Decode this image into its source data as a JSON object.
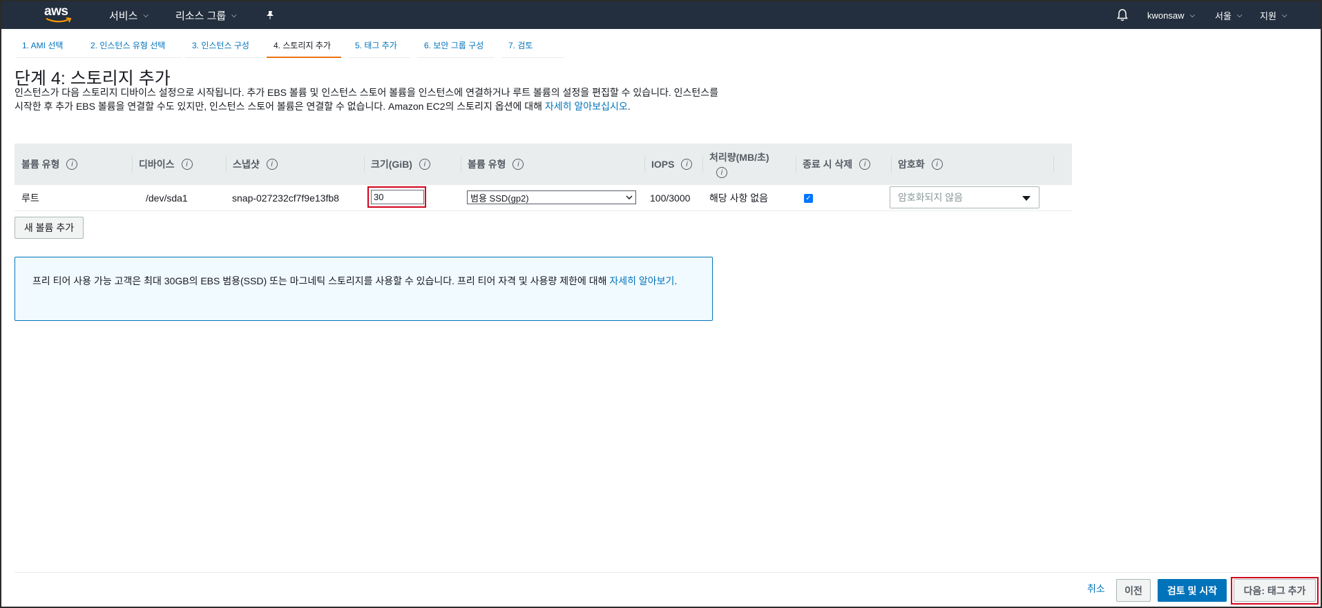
{
  "nav": {
    "logo": "aws",
    "services": "서비스",
    "resource_groups": "리소스 그룹",
    "user": "kwonsaw",
    "region": "서울",
    "support": "지원"
  },
  "tabs": [
    {
      "label": "1. AMI 선택"
    },
    {
      "label": "2. 인스턴스 유형 선택"
    },
    {
      "label": "3. 인스턴스 구성"
    },
    {
      "label": "4. 스토리지 추가"
    },
    {
      "label": "5. 태그 추가"
    },
    {
      "label": "6. 보안 그룹 구성"
    },
    {
      "label": "7. 검토"
    }
  ],
  "page": {
    "title": "단계 4: 스토리지 추가",
    "description": "인스턴스가 다음 스토리지 디바이스 설정으로 시작됩니다. 추가 EBS 볼륨 및 인스턴스 스토어 볼륨을 인스턴스에 연결하거나 루트 볼륨의 설정을 편집할 수 있습니다. 인스턴스를 시작한 후 추가 EBS 볼륨을 연결할 수도 있지만, 인스턴스 스토어 볼륨은 연결할 수 없습니다. Amazon EC2의 스토리지 옵션에 대해 ",
    "description_link": "자세히 알아보십시오",
    "description_end": "."
  },
  "table": {
    "headers": {
      "volume_type": "볼륨 유형",
      "device": "디바이스",
      "snapshot": "스냅샷",
      "size": "크기(GiB)",
      "vol_kind": "볼륨 유형",
      "iops": "IOPS",
      "throughput": "처리량(MB/초)",
      "delete_on_term": "종료 시 삭제",
      "encryption": "암호화"
    },
    "info_glyph": "i",
    "row": {
      "volume_type": "루트",
      "device": "/dev/sda1",
      "snapshot": "snap-027232cf7f9e13fb8",
      "size": "30",
      "vol_kind": "범용 SSD(gp2)",
      "iops": "100/3000",
      "throughput": "해당 사항 없음",
      "delete_on_term": true,
      "encryption": "암호화되지 않음"
    }
  },
  "add_volume_button": "새 볼륨 추가",
  "info_box": {
    "text": "프리 티어 사용 가능 고객은 최대 30GB의 EBS 범용(SSD) 또는 마그네틱 스토리지를 사용할 수 있습니다. 프리 티어 자격 및 사용량 제한에 대해 ",
    "link": "자세히 알아보기",
    "end": "."
  },
  "footer": {
    "cancel": "취소",
    "previous": "이전",
    "review_launch": "검토 및 시작",
    "next": "다음: 태그 추가"
  }
}
